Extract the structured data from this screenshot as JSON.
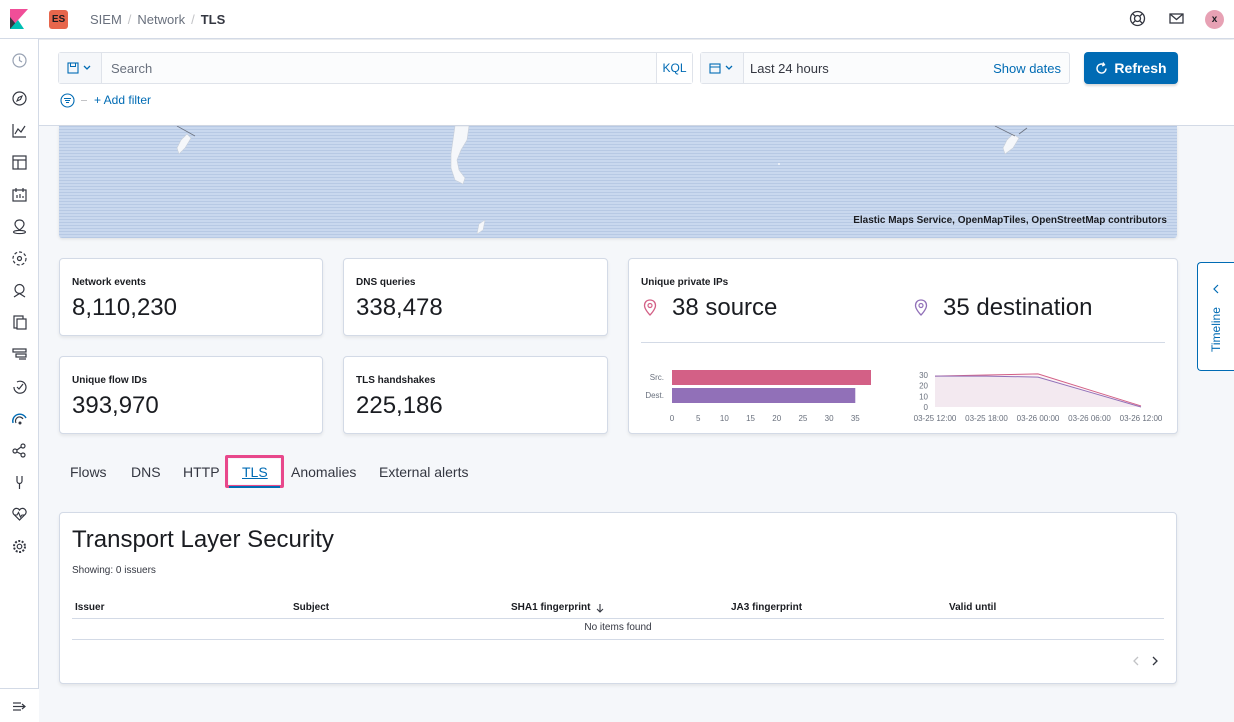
{
  "header": {
    "space_badge": "ES",
    "breadcrumbs": [
      "SIEM",
      "Network",
      "TLS"
    ],
    "user_initial": "x"
  },
  "search": {
    "placeholder": "Search",
    "language": "KQL",
    "date_range": "Last 24 hours",
    "show_dates": "Show dates",
    "refresh_label": "Refresh",
    "add_filter": "+ Add filter"
  },
  "map": {
    "attribution": "Elastic Maps Service, OpenMapTiles, OpenStreetMap contributors"
  },
  "stats": {
    "network_events": {
      "label": "Network events",
      "value": "8,110,230"
    },
    "dns_queries": {
      "label": "DNS queries",
      "value": "338,478"
    },
    "unique_flow_ids": {
      "label": "Unique flow IDs",
      "value": "393,970"
    },
    "tls_handshakes": {
      "label": "TLS handshakes",
      "value": "225,186"
    },
    "unique_private_ips": {
      "label": "Unique private IPs",
      "source": "38 source",
      "destination": "35 destination"
    }
  },
  "chart_data": [
    {
      "type": "bar",
      "orientation": "horizontal",
      "categories": [
        "Src.",
        "Dest."
      ],
      "values": [
        38,
        35
      ],
      "colors": [
        "#d36086",
        "#9170b8"
      ],
      "xticks": [
        "0",
        "5",
        "10",
        "15",
        "20",
        "25",
        "30",
        "35"
      ],
      "xlim": [
        0,
        38
      ]
    },
    {
      "type": "area",
      "x": [
        "03-25 12:00",
        "03-25 18:00",
        "03-26 00:00",
        "03-26 06:00",
        "03-26 12:00"
      ],
      "yticks": [
        "0",
        "10",
        "20",
        "30"
      ],
      "ylim": [
        0,
        30
      ],
      "series": [
        {
          "values": [
            29,
            30,
            31,
            16,
            1
          ],
          "color": "#d36086"
        },
        {
          "values": [
            29,
            29,
            28,
            14,
            0
          ],
          "color": "#9170b8"
        }
      ]
    }
  ],
  "tabs": [
    "Flows",
    "DNS",
    "HTTP",
    "TLS",
    "Anomalies",
    "External alerts"
  ],
  "tls_table": {
    "title": "Transport Layer Security",
    "showing": "Showing: 0 issuers",
    "columns": [
      "Issuer",
      "Subject",
      "SHA1 fingerprint",
      "JA3 fingerprint",
      "Valid until"
    ],
    "empty_message": "No items found"
  },
  "timeline": {
    "label": "Timeline"
  },
  "colors": {
    "accent": "#006bb4",
    "highlight": "#e8488b",
    "src": "#d36086",
    "dest": "#9170b8"
  }
}
